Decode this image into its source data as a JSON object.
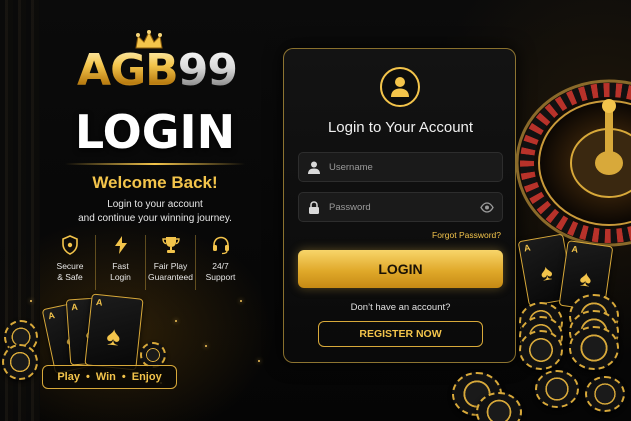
{
  "brand": {
    "logo_agb": "AGB",
    "logo_99": "99",
    "page_heading": "LOGIN",
    "welcome": "Welcome Back!",
    "welcome_sub_line1": "Login to your account",
    "welcome_sub_line2": "and continue your winning journey."
  },
  "features": [
    {
      "icon": "shield-icon",
      "label": "Secure\n& Safe"
    },
    {
      "icon": "lightning-icon",
      "label": "Fast\nLogin"
    },
    {
      "icon": "trophy-icon",
      "label": "Fair Play\nGuaranteed"
    },
    {
      "icon": "headset-icon",
      "label": "24/7\nSupport"
    }
  ],
  "tagline": {
    "play": "Play",
    "win": "Win",
    "enjoy": "Enjoy",
    "separator": "•"
  },
  "form": {
    "avatar_icon": "user-icon",
    "title": "Login to Your Account",
    "username": {
      "placeholder": "Username",
      "value": "",
      "icon": "user-icon"
    },
    "password": {
      "placeholder": "Password",
      "value": "",
      "icon": "lock-icon",
      "toggle_icon": "eye-icon"
    },
    "forgot_label": "Forgot Password?",
    "login_label": "LOGIN",
    "no_account_text": "Don’t have an account?",
    "register_label": "REGISTER NOW"
  },
  "playing_cards": {
    "corner": "A",
    "suit": "♠"
  },
  "colors": {
    "gold": "#f3c44b",
    "gold_dark": "#c68a14",
    "background": "#050505",
    "card_bg": "#141414"
  }
}
